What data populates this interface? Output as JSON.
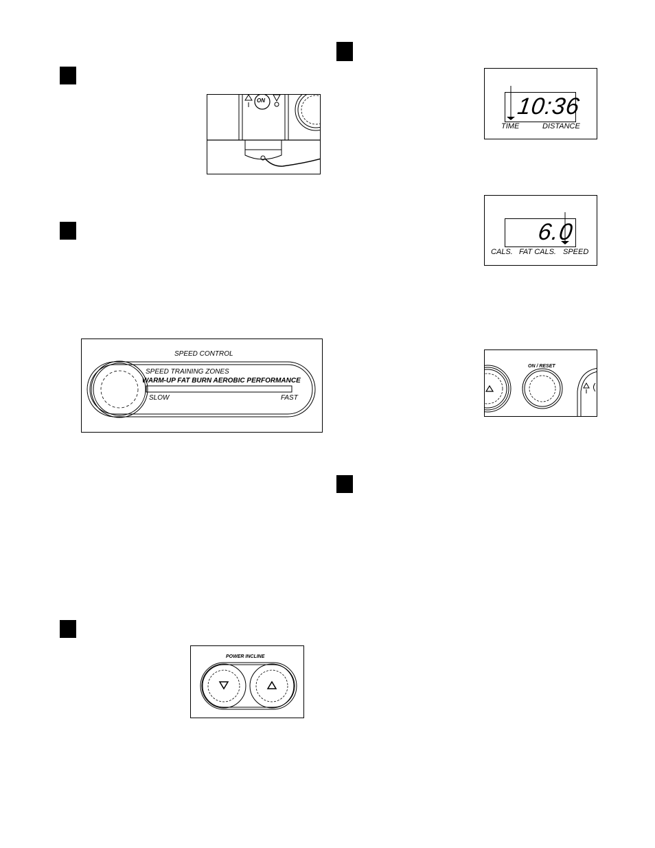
{
  "steps": [
    {
      "id": "step-1-marker"
    },
    {
      "id": "step-2-marker"
    },
    {
      "id": "step-3-marker"
    },
    {
      "id": "step-4-marker"
    },
    {
      "id": "step-5-marker"
    }
  ],
  "figure_key_on": {
    "on_label": "ON",
    "up_symbol": "△",
    "down_symbol": "▽",
    "up_mark": "I",
    "down_mark": "O"
  },
  "figure_speed_control": {
    "title": "SPEED CONTROL",
    "zones_title": "SPEED TRAINING ZONES",
    "zones": "WARM-UP  FAT BURN  AEROBIC  PERFORMANCE",
    "slow_label": "SLOW",
    "fast_label": "FAST"
  },
  "figure_power_incline": {
    "title": "POWER INCLINE",
    "down_symbol": "▽",
    "up_symbol": "△"
  },
  "figure_display_time": {
    "value": "10:36",
    "labels": [
      "TIME",
      "DISTANCE"
    ]
  },
  "figure_display_speed": {
    "value": "6.0",
    "labels": [
      "CALS.",
      "FAT CALS.",
      "SPEED"
    ]
  },
  "figure_on_reset": {
    "title": "ON / RESET",
    "up_symbol": "△"
  }
}
